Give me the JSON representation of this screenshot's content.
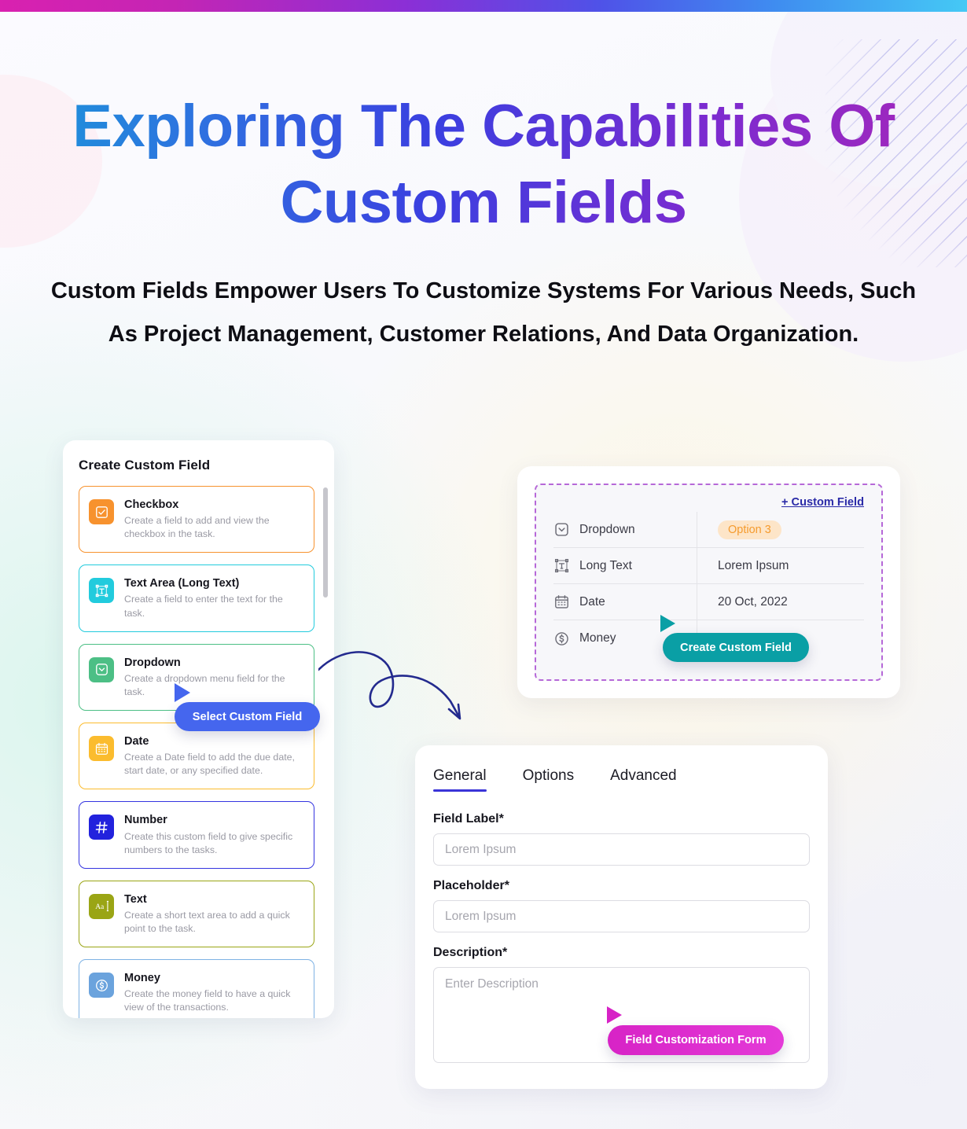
{
  "header": {
    "title_line1": "Exploring The Capabilities Of",
    "title_line2": "Custom Fields",
    "subtitle": "Custom Fields Empower Users To Customize Systems For Various Needs, Such As Project Management, Customer Relations, And Data Organization."
  },
  "colors": {
    "accent_blue": "#4566ee",
    "accent_teal": "#0a9fa5",
    "accent_magenta": "#d723c6",
    "tab_underline": "#3a34d8",
    "dashed_border": "#b668d8"
  },
  "left_card": {
    "title": "Create Custom Field",
    "items": [
      {
        "name": "Checkbox",
        "desc": "Create a field to add and view the checkbox in the task.",
        "icon": "checkbox-icon",
        "icon_color": "#f7922e",
        "border_color": "#f7922e"
      },
      {
        "name": "Text Area (Long Text)",
        "desc": "Create a field to enter the text for the task.",
        "icon": "long-text-icon",
        "icon_color": "#22cbdd",
        "border_color": "#22cbdd"
      },
      {
        "name": "Dropdown",
        "desc": "Create a dropdown menu field for the task.",
        "icon": "dropdown-icon",
        "icon_color": "#4cbf85",
        "border_color": "#4cbf85"
      },
      {
        "name": "Date",
        "desc": "Create a Date field to add the due date, start date, or any specified date.",
        "icon": "calendar-icon",
        "icon_color": "#fbbc2e",
        "border_color": "#fbbc2e"
      },
      {
        "name": "Number",
        "desc": "Create this custom field to give specific numbers to the tasks.",
        "icon": "hash-icon",
        "icon_color": "#2222dd",
        "border_color": "#3434e0"
      },
      {
        "name": "Text",
        "desc": "Create a short text area to add a quick point to the task.",
        "icon": "text-aa-icon",
        "icon_color": "#9aa515",
        "border_color": "#9aa515"
      },
      {
        "name": "Money",
        "desc": "Create the money field to have a quick view of the transactions.",
        "icon": "money-icon",
        "icon_color": "#6ba3dd",
        "border_color": "#7eb2e4"
      }
    ]
  },
  "badges": {
    "select_custom_field": "Select Custom Field",
    "create_custom_field": "Create Custom Field",
    "field_customization_form": "Field Customization Form"
  },
  "table_card": {
    "add_link": "+ Custom Field",
    "rows": [
      {
        "icon": "dropdown-icon",
        "label": "Dropdown",
        "value": "Option 3",
        "value_type": "badge"
      },
      {
        "icon": "long-text-icon",
        "label": "Long Text",
        "value": "Lorem Ipsum",
        "value_type": "text"
      },
      {
        "icon": "calendar-icon",
        "label": "Date",
        "value": "20 Oct, 2022",
        "value_type": "text"
      },
      {
        "icon": "money-icon",
        "label": "Money",
        "value": "",
        "value_type": "text"
      }
    ]
  },
  "form_card": {
    "tabs": [
      {
        "label": "General",
        "active": true
      },
      {
        "label": "Options",
        "active": false
      },
      {
        "label": "Advanced",
        "active": false
      }
    ],
    "fields": [
      {
        "label": "Field Label*",
        "placeholder": "Lorem Ipsum",
        "value": ""
      },
      {
        "label": "Placeholder*",
        "placeholder": "Lorem Ipsum",
        "value": ""
      },
      {
        "label": "Description*",
        "placeholder": "Enter Description",
        "value": ""
      }
    ]
  }
}
